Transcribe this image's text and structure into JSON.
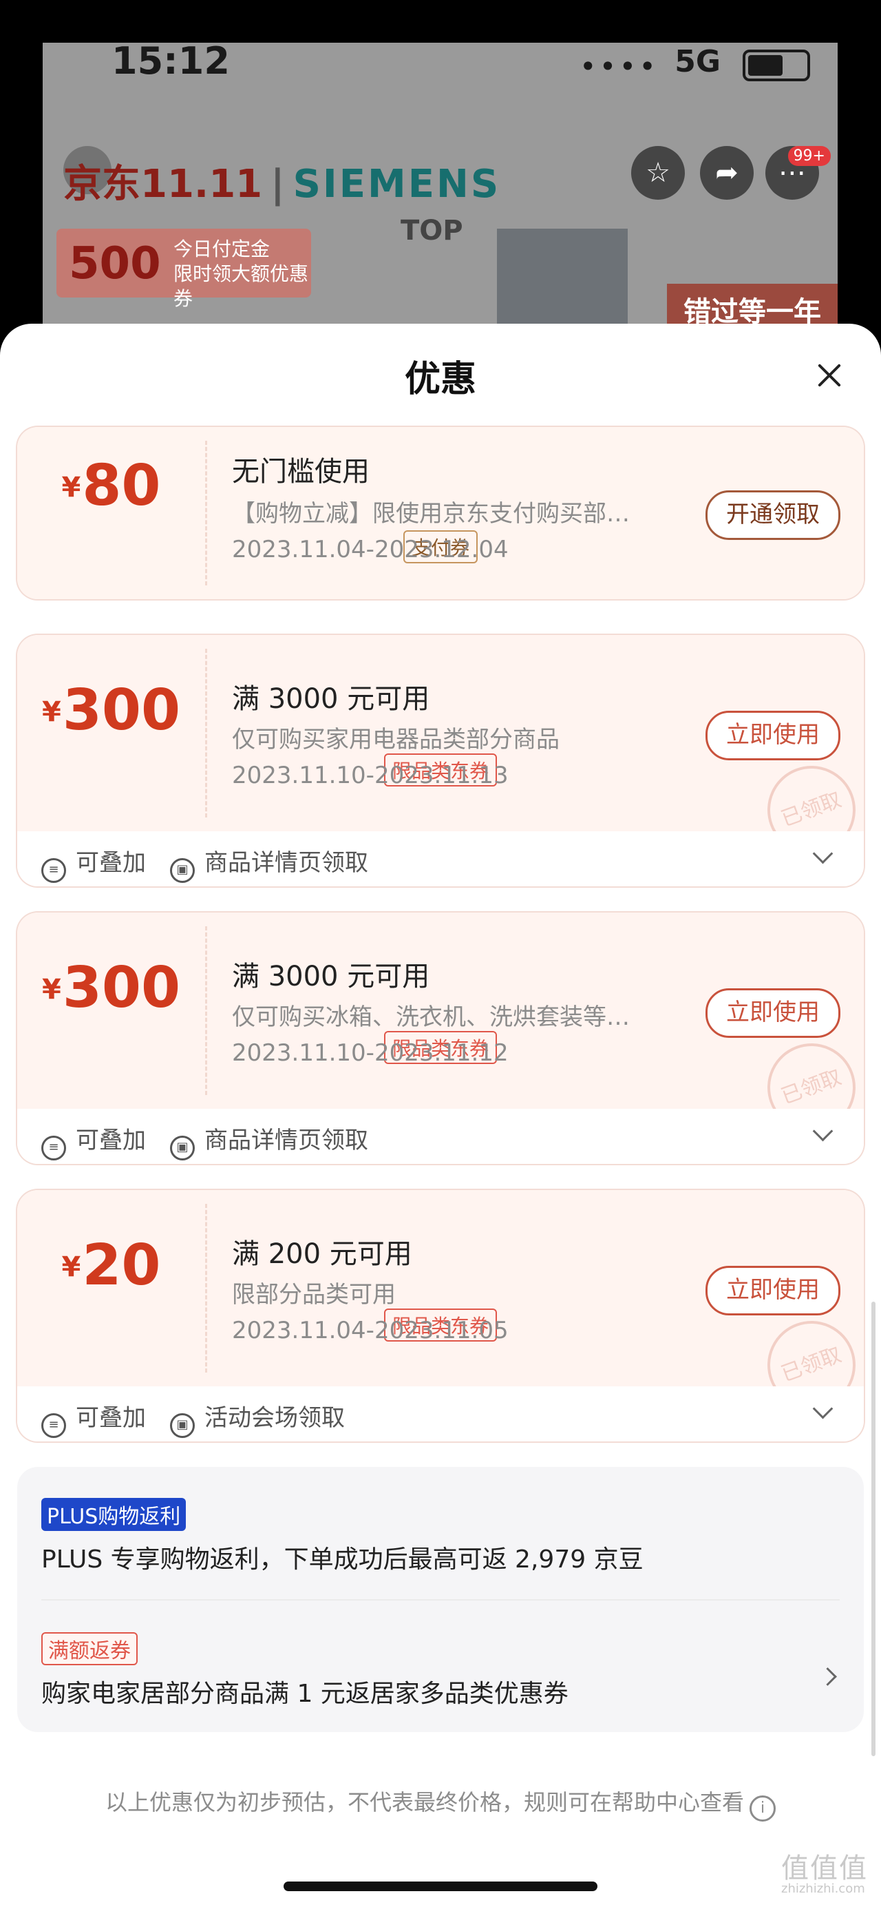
{
  "status": {
    "time": "15:12",
    "network": "5G",
    "signal": "••••"
  },
  "bg": {
    "brand": "京东11.11",
    "brand_partner": "SIEMENS",
    "badge_count": "99+",
    "promo_amount": "500",
    "promo_text1": "今日付定金",
    "promo_text2": "限时领大额优惠券",
    "top_label": "TOP",
    "miss_text": "错过等一年"
  },
  "sheet": {
    "title": "优惠"
  },
  "coupons": [
    {
      "yen": "¥",
      "amount": "80",
      "tag": "支付券",
      "condition": "无门槛使用",
      "desc": "【购物立减】限使用京东支付购买部分商品",
      "date": "2023.11.04-2023.12.04",
      "action": "开通领取"
    },
    {
      "yen": "¥",
      "amount": "300",
      "tag": "限品类东券",
      "condition": "满 3000 元可用",
      "desc": "仅可购买家用电器品类部分商品",
      "date": "2023.11.10-2023.11.13",
      "action": "立即使用",
      "stamp": "已领取",
      "footer1": "可叠加",
      "footer2": "商品详情页领取"
    },
    {
      "yen": "¥",
      "amount": "300",
      "tag": "限品类东券",
      "condition": "满 3000 元可用",
      "desc": "仅可购买冰箱、洗衣机、洗烘套装等部分商品",
      "date": "2023.11.10-2023.11.12",
      "action": "立即使用",
      "stamp": "已领取",
      "footer1": "可叠加",
      "footer2": "商品详情页领取"
    },
    {
      "yen": "¥",
      "amount": "20",
      "tag": "限品类东券",
      "condition": "满 200 元可用",
      "desc": "限部分品类可用",
      "date": "2023.11.04-2023.11.05",
      "action": "立即使用",
      "stamp": "已领取",
      "footer1": "可叠加",
      "footer2": "活动会场领取"
    }
  ],
  "plus": {
    "badge": "PLUS购物返利",
    "text": "PLUS 专享购物返利，下单成功后最高可返 2,979 京豆",
    "badge2": "满额返券",
    "text2": "购家电家居部分商品满 1 元返居家多品类优惠券"
  },
  "disclaimer": "以上优惠仅为初步预估，不代表最终价格，规则可在帮助中心查看",
  "watermark": "值值值",
  "watermark_url": "zhizhizhi.com"
}
